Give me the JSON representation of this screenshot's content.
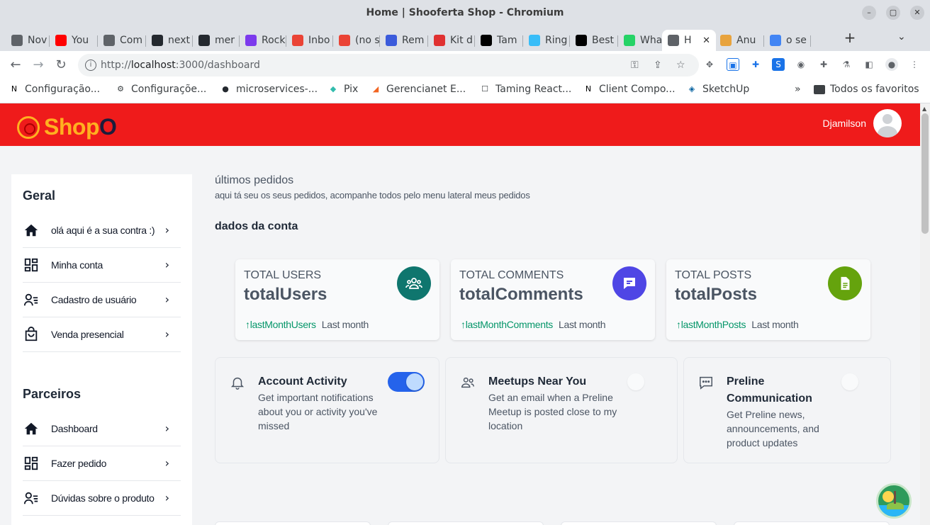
{
  "window": {
    "title": "Home | Shooferta Shop - Chromium"
  },
  "tabs": [
    {
      "label": "Nov",
      "icon": "globe-icon",
      "color": "#5f6368"
    },
    {
      "label": "You",
      "icon": "youtube-icon",
      "color": "#ff0000"
    },
    {
      "label": "Com",
      "icon": "globe-icon",
      "color": "#5f6368"
    },
    {
      "label": "next",
      "icon": "github-icon",
      "color": "#24292f"
    },
    {
      "label": "mer",
      "icon": "github-icon",
      "color": "#24292f"
    },
    {
      "label": "Rock",
      "icon": "rocketchat-icon",
      "color": "#7c3aed"
    },
    {
      "label": "Inbo",
      "icon": "gmail-icon",
      "color": "#ea4335"
    },
    {
      "label": "(no s",
      "icon": "gmail-icon",
      "color": "#ea4335"
    },
    {
      "label": "Rem",
      "icon": "remnote-icon",
      "color": "#3b5bdb"
    },
    {
      "label": "Kit d",
      "icon": "kit-icon",
      "color": "#e03131"
    },
    {
      "label": "Tam",
      "icon": "dev-icon",
      "color": "#000000"
    },
    {
      "label": "Ring",
      "icon": "tailwind-icon",
      "color": "#38bdf8"
    },
    {
      "label": "Best",
      "icon": "medium-icon",
      "color": "#000000"
    },
    {
      "label": "Wha",
      "icon": "whatsapp-icon",
      "color": "#25d366"
    },
    {
      "label": "H",
      "icon": "globe-icon",
      "color": "#5f6368",
      "active": true
    },
    {
      "label": "Anu",
      "icon": "food-icon",
      "color": "#e8a33d"
    },
    {
      "label": "o se",
      "icon": "google-icon",
      "color": "#4285f4"
    }
  ],
  "address_bar": {
    "host": "localhost",
    "prefix": "http://",
    "rest": ":3000/dashboard"
  },
  "bookmarks": [
    {
      "label": "Configuração...",
      "icon": "notion-icon"
    },
    {
      "label": "Configuraçõe...",
      "icon": "gear-icon"
    },
    {
      "label": "microservices-...",
      "icon": "github-icon"
    },
    {
      "label": "Pix",
      "icon": "pix-icon"
    },
    {
      "label": "Gerencianet E...",
      "icon": "gerencianet-icon"
    },
    {
      "label": "Taming React...",
      "icon": "page-icon"
    },
    {
      "label": "Client Compo...",
      "icon": "nextjs-icon"
    },
    {
      "label": "SketchUp",
      "icon": "sketchup-icon"
    }
  ],
  "bookmarks_more": "»",
  "bookmarks_all": "Todos os favoritos",
  "header": {
    "logo_main": "Shop",
    "logo_tail": "O",
    "user_name": "Djamilson"
  },
  "sidebar": {
    "groups": [
      {
        "title": "Geral",
        "items": [
          {
            "label": "olá aqui é a sua contra :)",
            "icon": "home-icon"
          },
          {
            "label": "Minha conta",
            "icon": "dashboard-icon"
          },
          {
            "label": "Cadastro de usuário",
            "icon": "user-list-icon"
          },
          {
            "label": "Venda presencial",
            "icon": "shopping-bag-icon"
          }
        ]
      },
      {
        "title": "Parceiros",
        "items": [
          {
            "label": "Dashboard",
            "icon": "home-icon"
          },
          {
            "label": "Fazer pedido",
            "icon": "dashboard-icon"
          },
          {
            "label": "Dúvidas sobre o produto",
            "icon": "user-list-icon"
          }
        ]
      }
    ]
  },
  "main": {
    "title": "últimos pedidos",
    "subtitle": "aqui tá seu os seus pedidos, acompanhe todos pelo menu lateral meus pedidos",
    "section": "dados da conta"
  },
  "stats": [
    {
      "label": "TOTAL USERS",
      "value": "totalUsers",
      "trend": "lastMonthUsers",
      "period": "Last month",
      "icon": "users-icon",
      "color": "#0f766e"
    },
    {
      "label": "TOTAL COMMENTS",
      "value": "totalComments",
      "trend": "lastMonthComments",
      "period": "Last month",
      "icon": "comment-icon",
      "color": "#4f46e5"
    },
    {
      "label": "TOTAL POSTS",
      "value": "totalPosts",
      "trend": "lastMonthPosts",
      "period": "Last month",
      "icon": "document-icon",
      "color": "#65a30d"
    }
  ],
  "settings": [
    {
      "title_lines": [
        "Account Activity"
      ],
      "desc_lines": [
        "Get important notifications",
        "about you or activity you've",
        "missed"
      ],
      "icon": "bell-icon",
      "on": true
    },
    {
      "title_lines": [
        "Meetups Near You"
      ],
      "desc_lines": [
        "Get an email when a Preline",
        "Meetup is posted close to my",
        "location"
      ],
      "icon": "people-icon",
      "on": false
    },
    {
      "title_lines": [
        "Preline",
        "Communication"
      ],
      "desc_lines": [
        "Get Preline news,",
        "announcements, and",
        "product updates"
      ],
      "icon": "chat-icon",
      "on": false
    }
  ],
  "colors": {
    "header_red": "#ef1b1b",
    "logo_yellow": "#ffb020",
    "toggle_on": "#2563eb",
    "trend_green": "#059669"
  }
}
